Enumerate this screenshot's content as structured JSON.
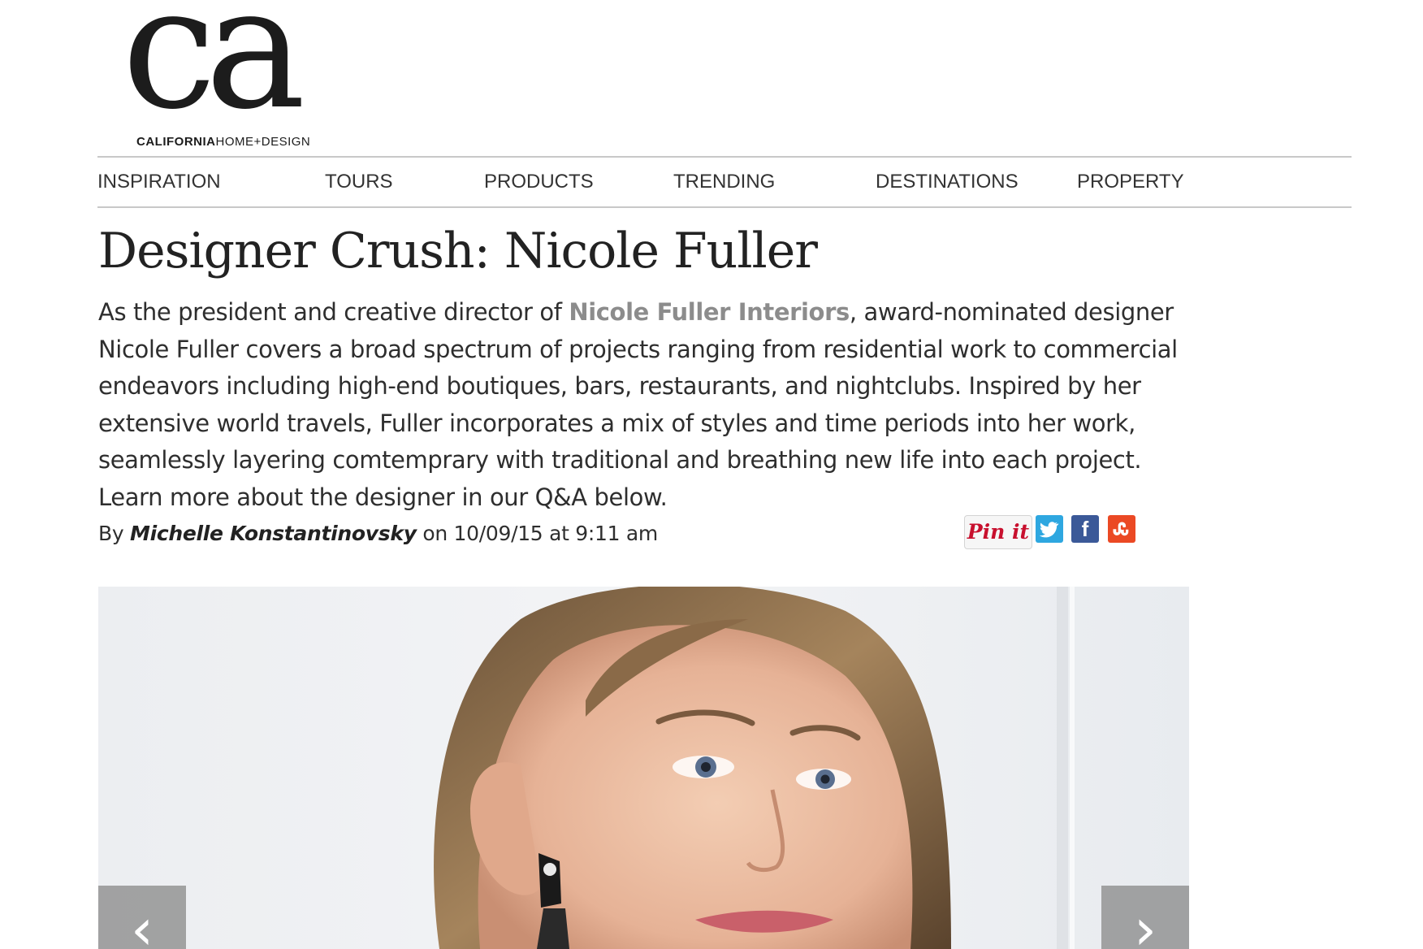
{
  "brand": {
    "logo_mark": "ca",
    "logo_sub_bold": "CALIFORNIA",
    "logo_sub_rest": "HOME+DESIGN"
  },
  "nav": {
    "items": [
      {
        "label": "INSPIRATION"
      },
      {
        "label": "TOURS"
      },
      {
        "label": "PRODUCTS"
      },
      {
        "label": "TRENDING"
      },
      {
        "label": "DESTINATIONS"
      },
      {
        "label": "PROPERTY"
      }
    ]
  },
  "article": {
    "title": "Designer Crush: Nicole Fuller",
    "intro_before": "As the president and creative director of ",
    "intro_link": "Nicole Fuller Interiors",
    "intro_after": ", award-nominated designer Nicole Fuller covers a broad spectrum of projects ranging from residential work to commercial endeavors including high-end boutiques, bars, restaurants, and nightclubs. Inspired by her extensive world travels, Fuller incorporates a mix of styles and time periods into her work, seamlessly layering comtemprary with traditional and breathing new life into each project. Learn more about the designer in our Q&A below.",
    "byline_prefix": "By ",
    "author": "Michelle Konstantinovsky",
    "byline_suffix": " on 10/09/15 at 9:11 am"
  },
  "share": {
    "pinterest_label": "Pin it",
    "twitter_icon": "twitter-icon",
    "facebook_icon": "facebook-icon",
    "stumbleupon_icon": "stumbleupon-icon",
    "twitter_glyph": "t",
    "facebook_glyph": "f",
    "stumbleupon_glyph": "su"
  },
  "slideshow": {
    "prev_glyph": "‹",
    "next_glyph": "›"
  },
  "colors": {
    "link_gray": "#8c8c8c",
    "pinterest_red": "#c8102e",
    "twitter_blue": "#2ea7e0",
    "facebook_blue": "#3b5998",
    "stumbleupon_orange": "#eb4924"
  }
}
